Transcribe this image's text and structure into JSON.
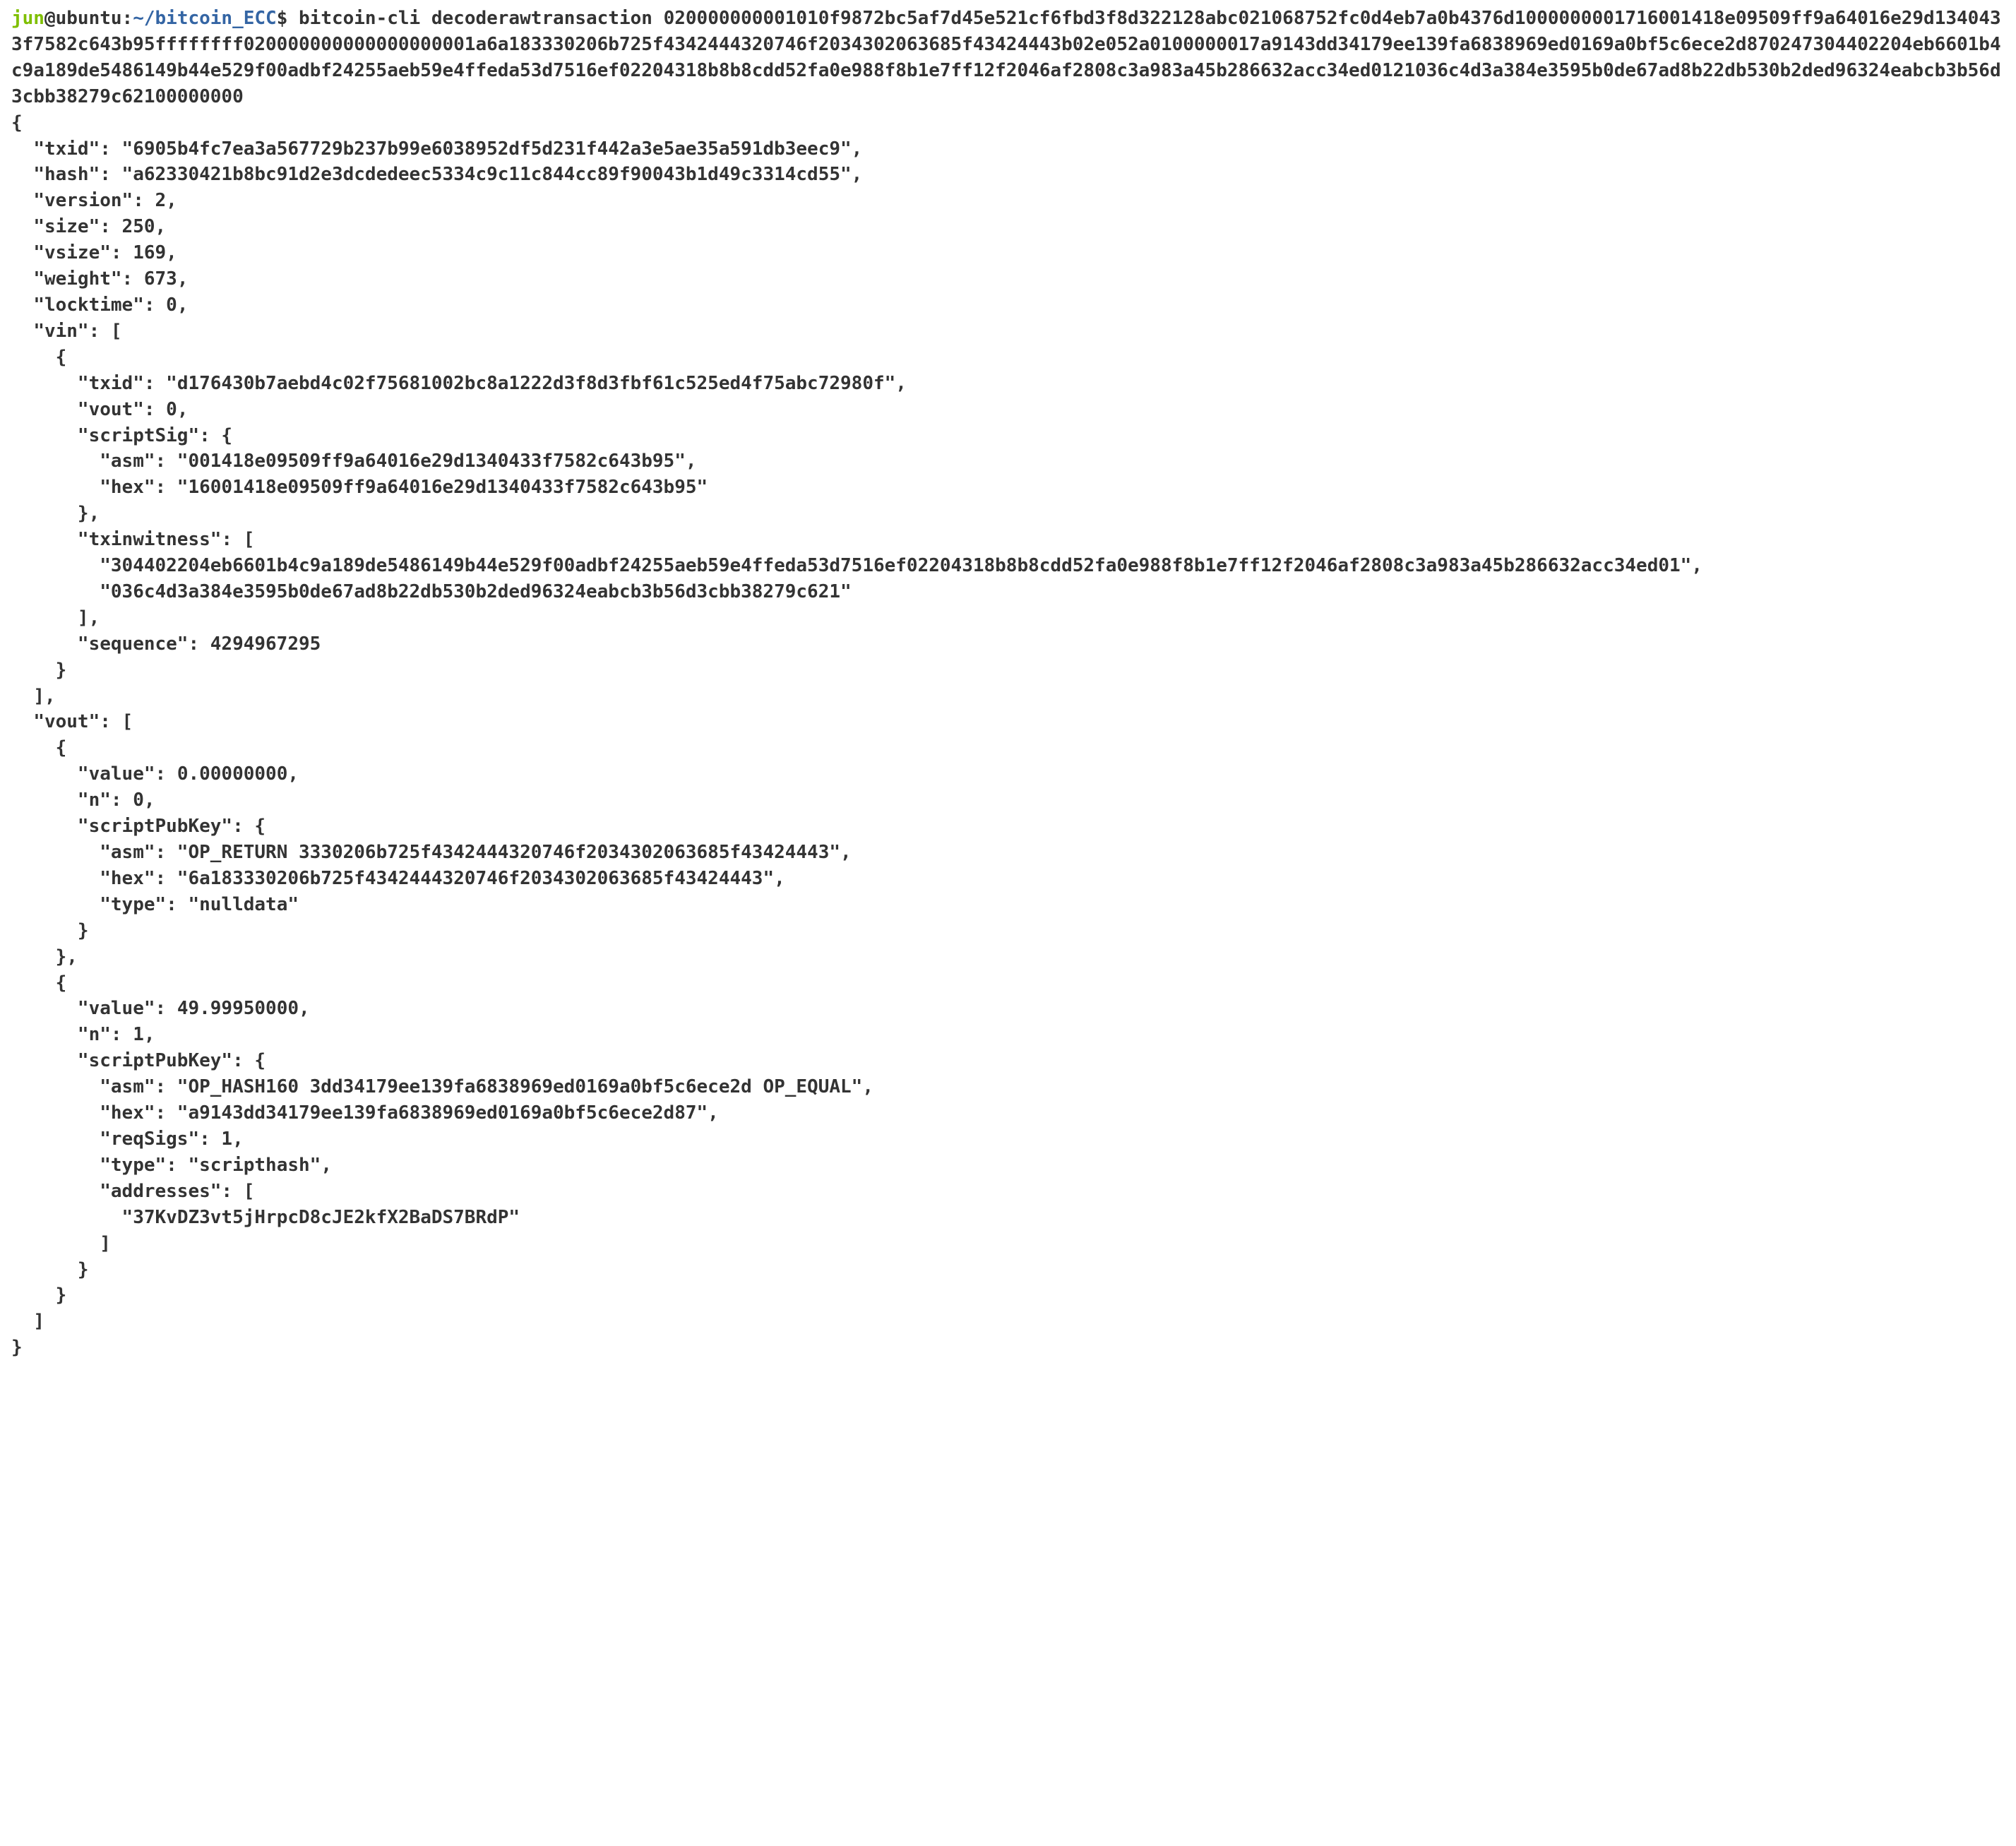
{
  "prompt": {
    "user": "jun",
    "at": "@",
    "host": "ubuntu",
    "colon": ":",
    "path": "~/bitcoin_ECC",
    "dollar": "$",
    "command": "bitcoin-cli decoderawtransaction 020000000001010f9872bc5af7d45e521cf6fbd3f8d322128abc021068752fc0d4eb7a0b4376d1000000001716001418e09509ff9a64016e29d1340433f7582c643b95ffffffff020000000000000000001a6a183330206b725f4342444320746f2034302063685f43424443b02e052a0100000017a9143dd34179ee139fa6838969ed0169a0bf5c6ece2d870247304402204eb6601b4c9a189de5486149b44e529f00adbf24255aeb59e4ffeda53d7516ef02204318b8b8cdd52fa0e988f8b1e7ff12f2046af2808c3a983a45b286632acc34ed0121036c4d3a384e3595b0de67ad8b22db530b2ded96324eabcb3b56d3cbb38279c62100000000"
  },
  "output": {
    "txid": "6905b4fc7ea3a567729b237b99e6038952df5d231f442a3e5ae35a591db3eec9",
    "hash": "a62330421b8bc91d2e3dcdedeec5334c9c11c844cc89f90043b1d49c3314cd55",
    "version": 2,
    "size": 250,
    "vsize": 169,
    "weight": 673,
    "locktime": 0,
    "vin": [
      {
        "txid": "d176430b7aebd4c02f75681002bc8a1222d3f8d3fbf61c525ed4f75abc72980f",
        "vout": 0,
        "scriptSig": {
          "asm": "001418e09509ff9a64016e29d1340433f7582c643b95",
          "hex": "16001418e09509ff9a64016e29d1340433f7582c643b95"
        },
        "txinwitness": [
          "304402204eb6601b4c9a189de5486149b44e529f00adbf24255aeb59e4ffeda53d7516ef02204318b8b8cdd52fa0e988f8b1e7ff12f2046af2808c3a983a45b286632acc34ed01",
          "036c4d3a384e3595b0de67ad8b22db530b2ded96324eabcb3b56d3cbb38279c621"
        ],
        "sequence": 4294967295
      }
    ],
    "vout": [
      {
        "value_str": "0.00000000",
        "n": 0,
        "scriptPubKey": {
          "asm": "OP_RETURN 3330206b725f4342444320746f2034302063685f43424443",
          "hex": "6a183330206b725f4342444320746f2034302063685f43424443",
          "type": "nulldata"
        }
      },
      {
        "value_str": "49.99950000",
        "n": 1,
        "scriptPubKey": {
          "asm": "OP_HASH160 3dd34179ee139fa6838969ed0169a0bf5c6ece2d OP_EQUAL",
          "hex": "a9143dd34179ee139fa6838969ed0169a0bf5c6ece2d87",
          "reqSigs": 1,
          "type": "scripthash",
          "addresses": [
            "37KvDZ3vt5jHrpcD8cJE2kfX2BaDS7BRdP"
          ]
        }
      }
    ]
  }
}
